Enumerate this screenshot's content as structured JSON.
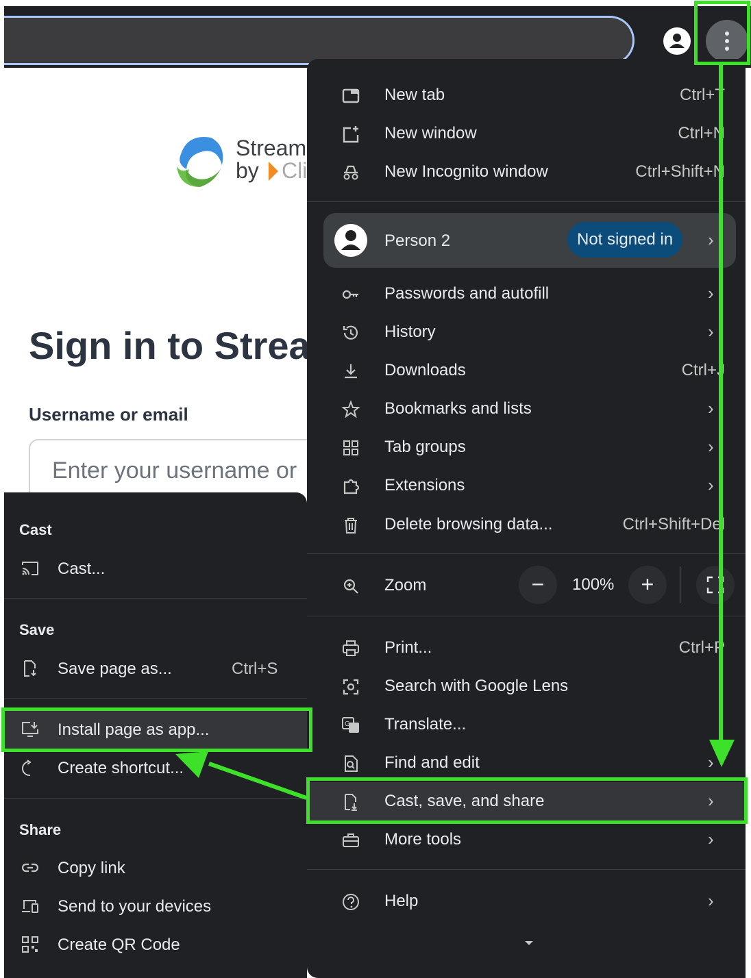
{
  "page": {
    "brand_line1": "Stream",
    "brand_by": "by",
    "brand_cli": "Cli",
    "signin_title": "Sign in to Strear",
    "username_label": "Username or email",
    "username_placeholder": "Enter your username or"
  },
  "menu": {
    "items_top": [
      {
        "label": "New tab",
        "shortcut": "Ctrl+T",
        "icon": "new-tab-icon"
      },
      {
        "label": "New window",
        "shortcut": "Ctrl+N",
        "icon": "new-window-icon"
      },
      {
        "label": "New Incognito window",
        "shortcut": "Ctrl+Shift+N",
        "icon": "incognito-icon"
      }
    ],
    "person": {
      "name": "Person 2",
      "status": "Not signed in"
    },
    "items_mid": [
      {
        "label": "Passwords and autofill",
        "shortcut": "",
        "icon": "key-icon"
      },
      {
        "label": "History",
        "shortcut": "",
        "icon": "history-icon"
      },
      {
        "label": "Downloads",
        "shortcut": "Ctrl+J",
        "icon": "download-icon"
      },
      {
        "label": "Bookmarks and lists",
        "shortcut": "",
        "icon": "star-icon"
      },
      {
        "label": "Tab groups",
        "shortcut": "",
        "icon": "tab-groups-icon"
      },
      {
        "label": "Extensions",
        "shortcut": "",
        "icon": "extensions-icon"
      },
      {
        "label": "Delete browsing data...",
        "shortcut": "Ctrl+Shift+Del",
        "icon": "trash-icon"
      }
    ],
    "zoom": {
      "label": "Zoom",
      "value": "100%",
      "minus": "−",
      "plus": "+"
    },
    "items_bottom": [
      {
        "label": "Print...",
        "shortcut": "Ctrl+P",
        "icon": "print-icon"
      },
      {
        "label": "Search with Google Lens",
        "shortcut": "",
        "icon": "lens-icon"
      },
      {
        "label": "Translate...",
        "shortcut": "",
        "icon": "translate-icon"
      },
      {
        "label": "Find and edit",
        "shortcut": "",
        "icon": "find-icon"
      },
      {
        "label": "Cast, save, and share",
        "shortcut": "",
        "icon": "cast-save-icon"
      },
      {
        "label": "More tools",
        "shortcut": "",
        "icon": "toolbox-icon"
      }
    ],
    "help": {
      "label": "Help",
      "icon": "help-icon"
    }
  },
  "submenu": {
    "cast_header": "Cast",
    "cast_item": "Cast...",
    "save_header": "Save",
    "save_item": "Save page as...",
    "save_shortcut": "Ctrl+S",
    "install_item": "Install page as app...",
    "shortcut_item": "Create shortcut...",
    "share_header": "Share",
    "copy_link": "Copy link",
    "send_devices": "Send to your devices",
    "qr_code": "Create QR Code"
  },
  "colors": {
    "highlight": "#3ee12a",
    "menu_bg": "#202124",
    "badge": "#0b4c7a"
  }
}
